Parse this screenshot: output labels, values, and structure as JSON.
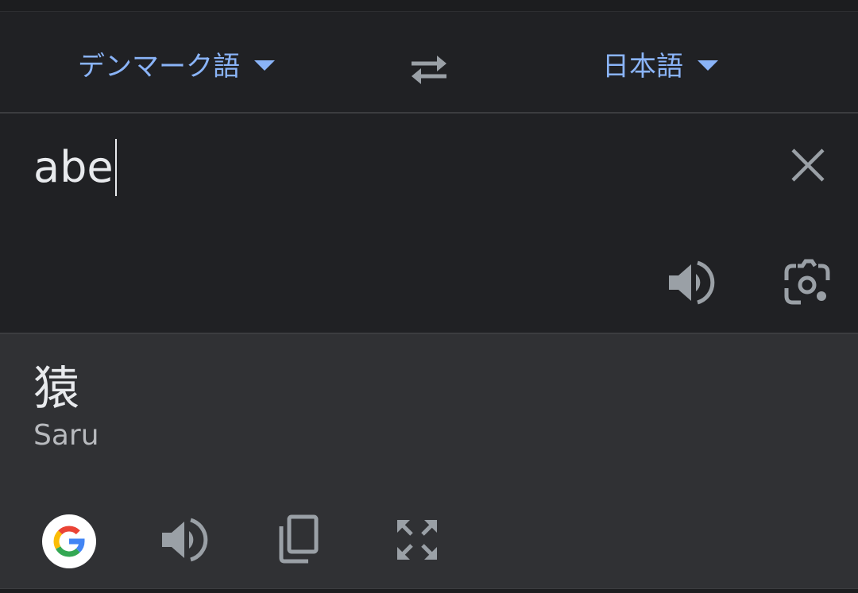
{
  "language_bar": {
    "source_language": "デンマーク語",
    "target_language": "日本語",
    "accent_color": "#8ab4f8",
    "swap_icon": "swap-arrows-icon",
    "dropdown_icon": "caret-down-icon"
  },
  "input": {
    "text": "abe",
    "clear_icon": "close-icon",
    "speak_icon": "speaker-icon",
    "camera_icon": "camera-lens-icon"
  },
  "result": {
    "translation": "猿",
    "romanization": "Saru",
    "google_icon": "google-g-icon",
    "speak_icon": "speaker-icon",
    "copy_icon": "copy-icon",
    "fullscreen_icon": "fullscreen-icon"
  },
  "colors": {
    "background": "#202124",
    "result_background": "#303134",
    "icon_gray": "#9aa0a6",
    "text": "#e8eaed"
  }
}
